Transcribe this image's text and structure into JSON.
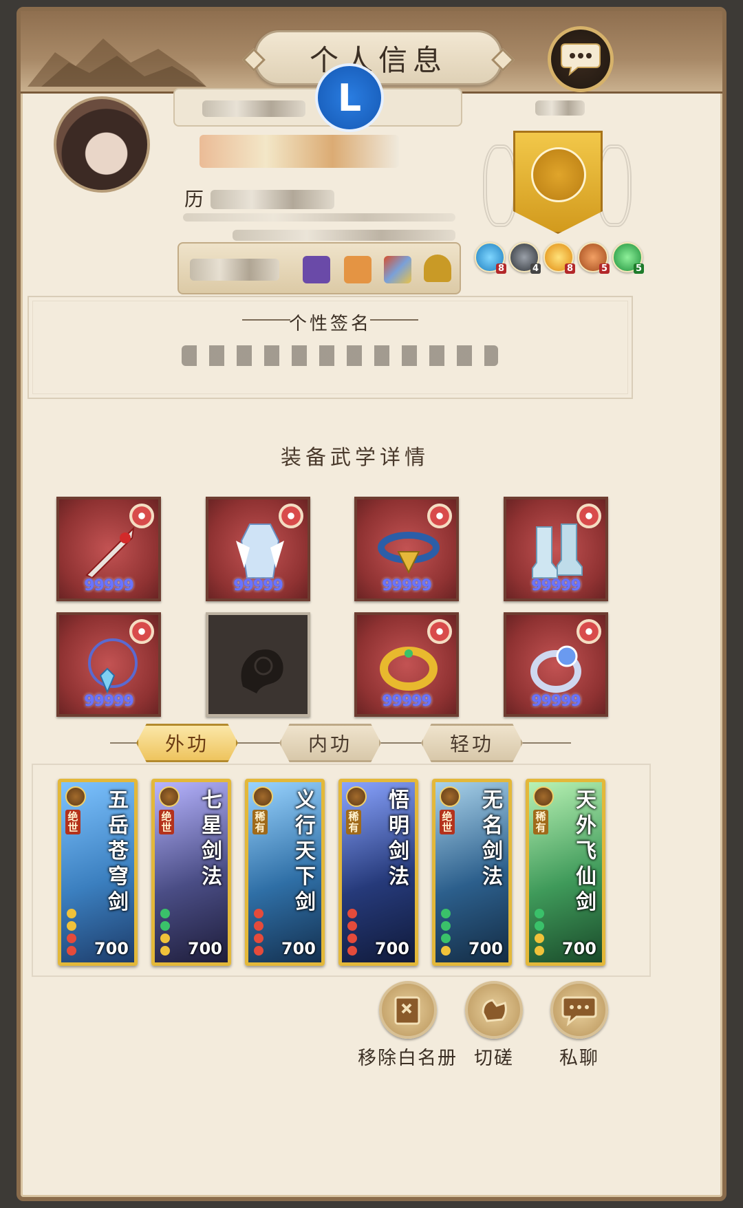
{
  "header": {
    "title": "个人信息",
    "chat_icon": "speech-bubble-icon"
  },
  "profile": {
    "history_label": "历",
    "rank_badge_letter": "L"
  },
  "titles": {
    "counts": [
      "8",
      "4",
      "8",
      "5",
      "5"
    ]
  },
  "signature": {
    "title": "个性签名"
  },
  "equipment": {
    "heading": "装备武学详情",
    "slots": [
      {
        "name": "sword",
        "level": "99999",
        "empty": false
      },
      {
        "name": "robe",
        "level": "99999",
        "empty": false
      },
      {
        "name": "belt",
        "level": "99999",
        "empty": false
      },
      {
        "name": "boots",
        "level": "99999",
        "empty": false
      },
      {
        "name": "necklace",
        "level": "99999",
        "empty": false
      },
      {
        "name": "locked-slot",
        "level": "",
        "empty": true
      },
      {
        "name": "gold-ring",
        "level": "99999",
        "empty": false
      },
      {
        "name": "silver-ring",
        "level": "99999",
        "empty": false
      }
    ]
  },
  "tabs": [
    {
      "label": "外功",
      "active": true
    },
    {
      "label": "内功",
      "active": false
    },
    {
      "label": "轻功",
      "active": false
    }
  ],
  "skills": [
    {
      "name": "五岳苍穹剑",
      "rank": "绝世",
      "power": "700",
      "bg": "#3b7fbf"
    },
    {
      "name": "七星剑法",
      "rank": "绝世",
      "power": "700",
      "bg": "#4a4d85"
    },
    {
      "name": "义行天下剑",
      "rank": "稀有",
      "power": "700",
      "bg": "#2f6fa6"
    },
    {
      "name": "悟明剑法",
      "rank": "稀有",
      "power": "700",
      "bg": "#263a7a"
    },
    {
      "name": "无名剑法",
      "rank": "绝世",
      "power": "700",
      "bg": "#2c5f8c"
    },
    {
      "name": "天外飞仙剑",
      "rank": "稀有",
      "power": "700",
      "bg": "#3f9a5a"
    }
  ],
  "actions": [
    {
      "label": "移除白名册",
      "icon": "book-icon"
    },
    {
      "label": "切磋",
      "icon": "fist-icon"
    },
    {
      "label": "私聊",
      "icon": "chat-icon"
    }
  ]
}
